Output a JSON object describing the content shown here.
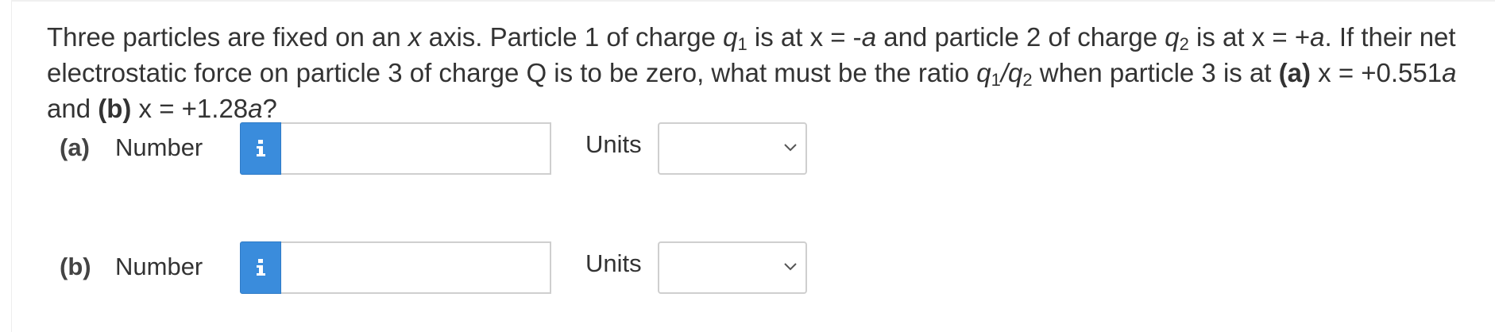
{
  "question": {
    "s1": "Three particles are fixed on an ",
    "x1": "x",
    "s2": " axis. Particle 1 of charge ",
    "q1": "q",
    "q1sub": "1",
    "s3": " is at x = -",
    "a1": "a",
    "s4": " and particle 2 of charge ",
    "q2": "q",
    "q2sub": "2",
    "s5": " is at x = +",
    "a2": "a",
    "s6": ". If their net electrostatic force on particle 3 of charge Q is to be zero, what must be the ratio ",
    "r1": "q",
    "r1sub": "1",
    "rslash": "/",
    "r2": "q",
    "r2sub": "2",
    "s7": " when particle 3 is at ",
    "partA": "(a)",
    "s8": " x = +0.551",
    "a3": "a",
    "s9": " and ",
    "partB": "(b)",
    "s10": " x = +1.28",
    "a4": "a",
    "s11": "?"
  },
  "parts": [
    {
      "label": "(a)",
      "field_label": "Number",
      "value": "",
      "units_label": "Units",
      "units_value": ""
    },
    {
      "label": "(b)",
      "field_label": "Number",
      "value": "",
      "units_label": "Units",
      "units_value": ""
    }
  ],
  "icons": {
    "info": "info-icon",
    "chevron": "chevron-down-icon"
  },
  "colors": {
    "info_button": "#3a8cdc",
    "text": "#333333",
    "border": "#cfcfcf"
  }
}
